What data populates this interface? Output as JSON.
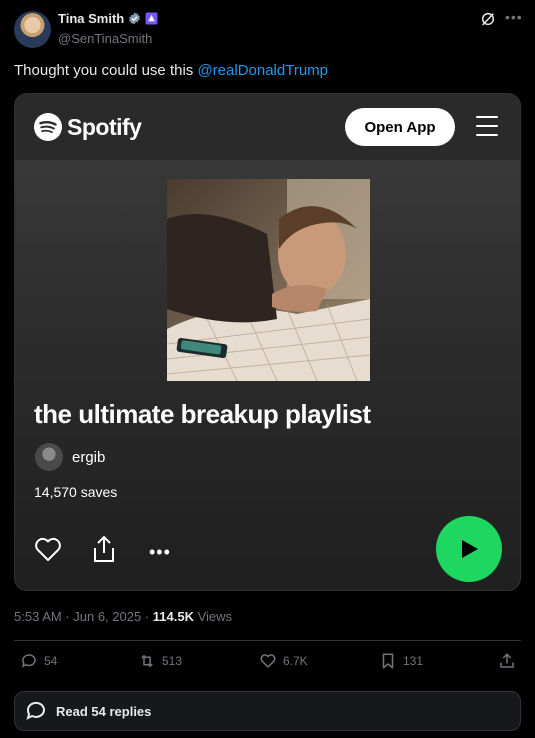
{
  "author": {
    "name": "Tina Smith",
    "handle": "@SenTinaSmith"
  },
  "tweet": {
    "text": "Thought you could use this ",
    "mention": "@realDonaldTrump"
  },
  "card": {
    "brand": "Spotify",
    "open_app_label": "Open App",
    "playlist_title": "the ultimate breakup playlist",
    "owner": "ergib",
    "saves": "14,570 saves"
  },
  "meta": {
    "timestamp": "5:53 AM · Jun 6, 2025 · ",
    "views_count": "114.5K",
    "views_label": " Views"
  },
  "actions": {
    "replies": "54",
    "reposts": "513",
    "likes": "6.7K",
    "bookmarks": "131"
  },
  "read_replies_label": "Read 54 replies",
  "colors": {
    "accent_link": "#1d9bf0",
    "spotify_green": "#1ed760",
    "background": "#000000"
  }
}
